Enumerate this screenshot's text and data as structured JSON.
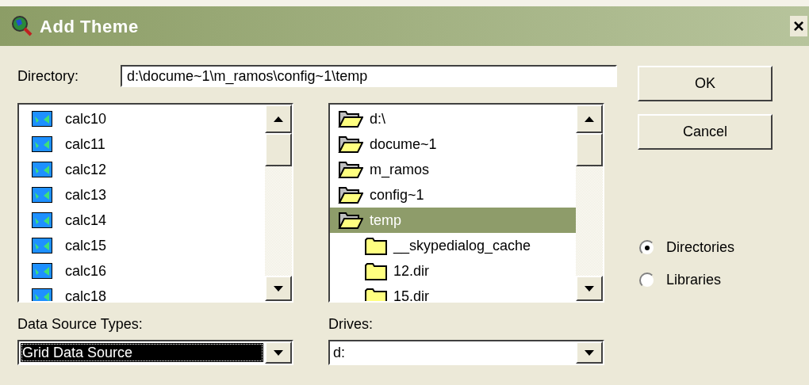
{
  "window": {
    "title": "Add Theme",
    "close": "×"
  },
  "directory": {
    "label": "Directory:",
    "value": "d:\\docume~1\\m_ramos\\config~1\\temp"
  },
  "sources": [
    {
      "name": "calc10",
      "selected": false
    },
    {
      "name": "calc11",
      "selected": false
    },
    {
      "name": "calc12",
      "selected": false
    },
    {
      "name": "calc13",
      "selected": false
    },
    {
      "name": "calc14",
      "selected": false
    },
    {
      "name": "calc15",
      "selected": false
    },
    {
      "name": "calc16",
      "selected": false
    },
    {
      "name": "calc18",
      "selected": false
    }
  ],
  "folders": [
    {
      "name": "d:\\",
      "expanded": true,
      "selected": false
    },
    {
      "name": "docume~1",
      "expanded": true,
      "selected": false
    },
    {
      "name": "m_ramos",
      "expanded": true,
      "selected": false
    },
    {
      "name": "config~1",
      "expanded": true,
      "selected": false
    },
    {
      "name": "temp",
      "expanded": true,
      "selected": true,
      "children": [
        {
          "name": "__skypedialog_cache",
          "expanded": false,
          "selected": false
        },
        {
          "name": "12.dir",
          "expanded": false,
          "selected": false
        },
        {
          "name": "15.dir",
          "expanded": false,
          "selected": false
        }
      ]
    }
  ],
  "data_source_types": {
    "label": "Data Source Types:",
    "value": "Grid Data Source",
    "focused": true
  },
  "drives": {
    "label": "Drives:",
    "value": "d:",
    "focused": false
  },
  "buttons": [
    "OK",
    "Cancel"
  ],
  "radios": [
    {
      "label": "Directories",
      "selected": true
    },
    {
      "label": "Libraries",
      "selected": false
    }
  ]
}
